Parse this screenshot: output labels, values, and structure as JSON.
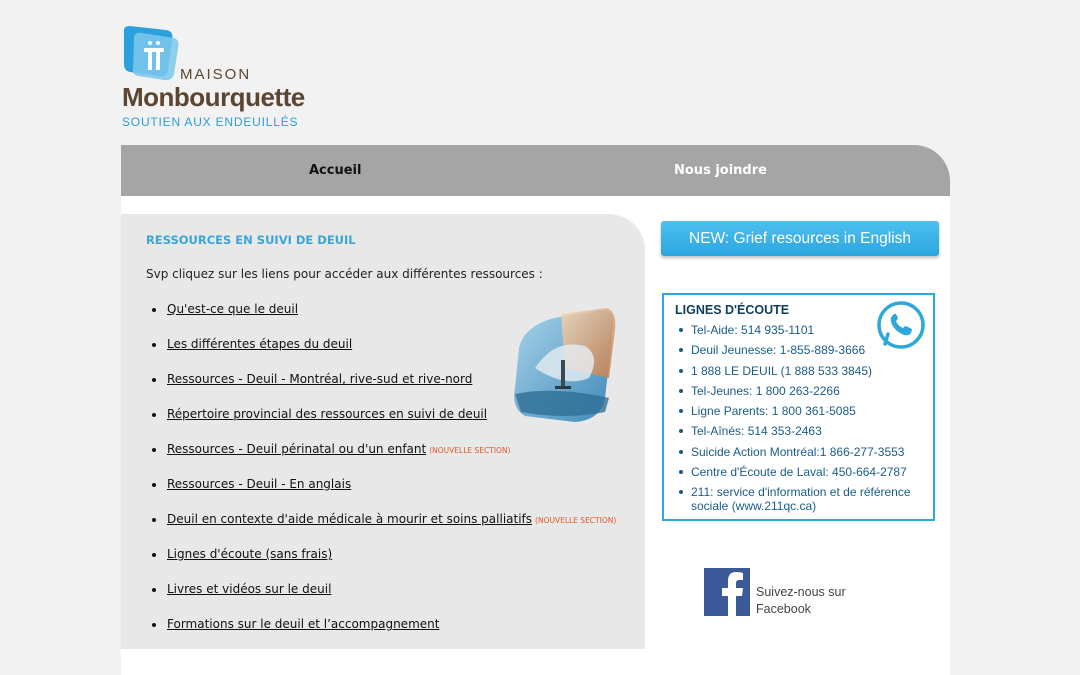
{
  "logo": {
    "maison": "MAISON",
    "brand": "Monbourquette",
    "tagline": "SOUTIEN AUX ENDEUILLÉS"
  },
  "nav": {
    "home": "Accueil",
    "contact": "Nous joindre"
  },
  "resources": {
    "title": "RESSOURCES EN SUIVI DE DEUIL",
    "intro": "Svp cliquez sur les liens pour accéder aux différentes ressources :",
    "items": [
      {
        "label": "Qu'est-ce que le deuil",
        "new": ""
      },
      {
        "label": "Les différentes étapes du deuil",
        "new": ""
      },
      {
        "label": "Ressources - Deuil - Montréal, rive-sud et rive-nord",
        "new": ""
      },
      {
        "label": "Répertoire provincial des ressources en suivi de deuil",
        "new": ""
      },
      {
        "label": "Ressources - Deuil périnatal ou d'un enfant",
        "new": "(nouvelle section)"
      },
      {
        "label": "Ressources - Deuil - En anglais",
        "new": ""
      },
      {
        "label": "Deuil en contexte d'aide médicale à mourir et soins palliatifs",
        "new": "(nouvelle section)"
      },
      {
        "label": "Lignes d'écoute (sans frais)",
        "new": ""
      },
      {
        "label": "Livres et vidéos sur le deuil",
        "new": ""
      },
      {
        "label": "Formations sur le deuil et l’accompagnement",
        "new": ""
      }
    ]
  },
  "english_button": "NEW: Grief resources in English",
  "hotlines": {
    "title": "LIGNES D'ÉCOUTE",
    "items": [
      "Tel-Aide: 514 935-1101",
      "Deuil Jeunesse: 1-855-889-3666",
      "1 888 LE DEUIL (1 888 533 3845)",
      "Tel-Jeunes: 1 800 263-2266",
      "Ligne Parents: 1 800 361-5085",
      "Tel-Aînés: 514 353-2463",
      "Suicide Action Montréal:1 866-277-3553",
      "Centre d'Écoute de Laval: 450-664-2787",
      "211: service d'information et de référence sociale (www.211qc.ca)"
    ]
  },
  "facebook": {
    "line1": "Suivez-nous sur",
    "line2": "Facebook"
  },
  "colors": {
    "accent": "#2ea8d9",
    "nav_bg": "#a5a5a5",
    "brand_brown": "#5a4632",
    "new_tag": "#e05a2a",
    "facebook": "#3b5998"
  }
}
